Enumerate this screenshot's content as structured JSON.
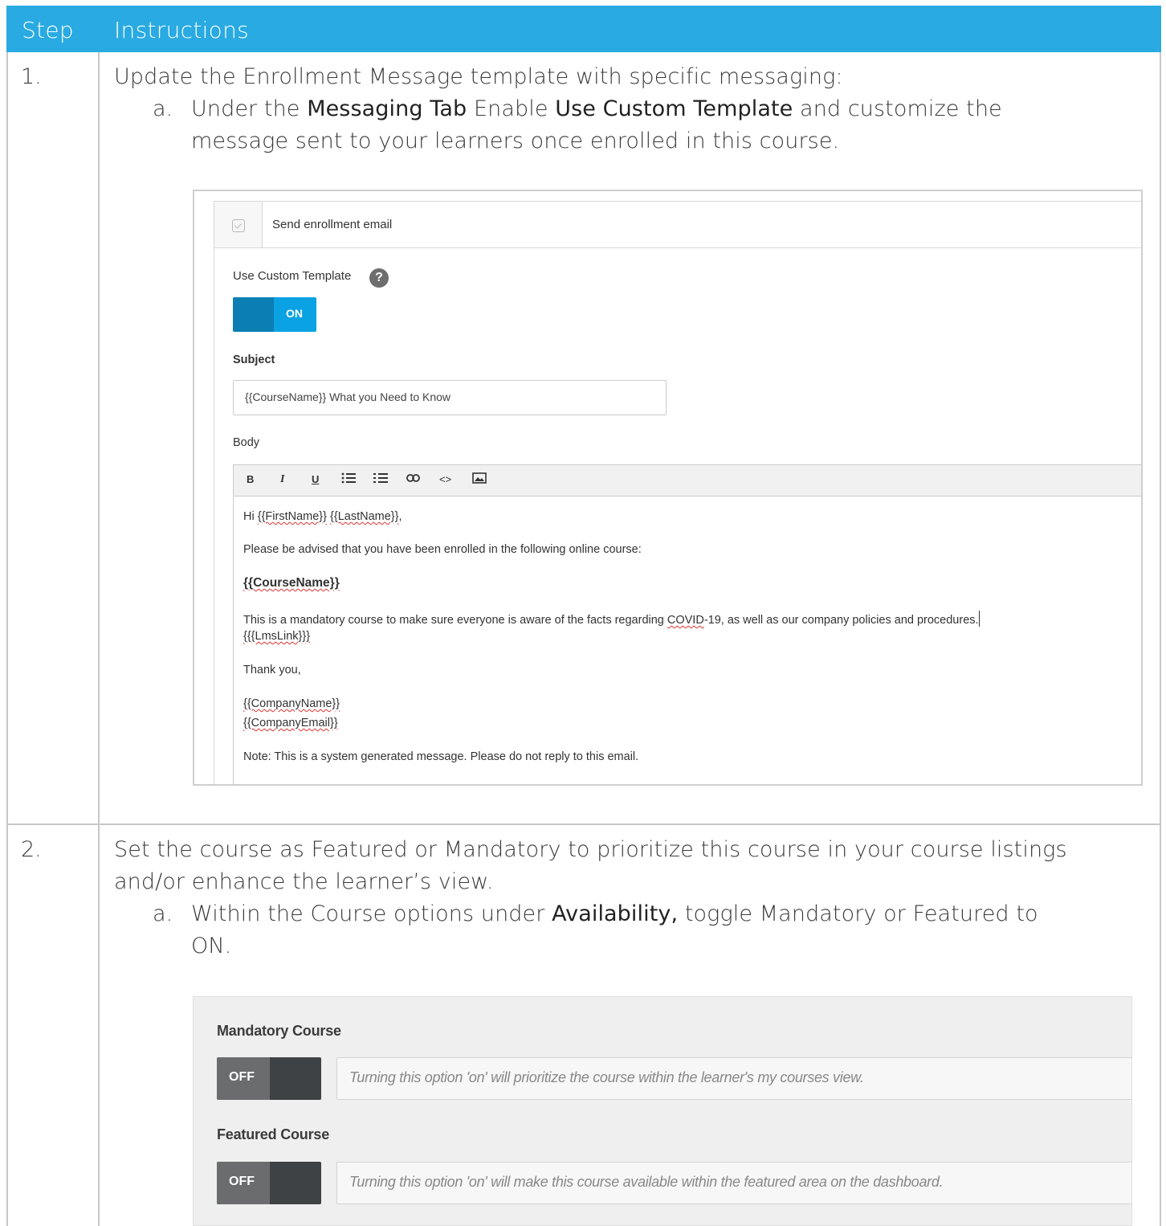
{
  "table": {
    "header": {
      "col1": "Step",
      "col2": "Instructions"
    },
    "row1": {
      "step": "1.",
      "intro": "Update the Enrollment Message template with specific messaging:",
      "sub_letter": "a.",
      "sub_pre": "Under the ",
      "sub_bold1": "Messaging Tab",
      "sub_mid": " Enable ",
      "sub_bold2": "Use Custom Template",
      "sub_post": " and customize the",
      "sub_line2": "message sent to your learners once enrolled in this course."
    },
    "row2": {
      "step": "2.",
      "intro_line1": "Set the course as Featured or Mandatory to prioritize this course in your course listings",
      "intro_line2": "and/or enhance the learner’s view.",
      "sub_letter": "a.",
      "sub_pre": "Within the Course options under ",
      "sub_bold": "Availability,",
      "sub_post": " toggle Mandatory or Featured to",
      "sub_line2": "ON."
    }
  },
  "screenshot1": {
    "send_email_label": "Send enrollment email",
    "custom_template_label": "Use Custom Template",
    "help_glyph": "?",
    "toggle_state": "ON",
    "subject_label": "Subject",
    "subject_value": "{{CourseName}} What you Need to Know",
    "body_label": "Body",
    "toolbar": {
      "bold": "B",
      "italic": "I",
      "underline": "U",
      "link": "ↂ",
      "code": "<>"
    },
    "body": {
      "greet_pre": "Hi ",
      "greet_first": "{{FirstName}}",
      "greet_space": " ",
      "greet_last": "{{LastName}}",
      "greet_post": ",",
      "advised": "Please be advised that you have been enrolled in the following online course:",
      "course_name": "{{CourseName}}",
      "mandatory_pre": "This is a mandatory course to make sure everyone is aware of the facts regarding ",
      "covid": "COVID",
      "mandatory_post": "-19, as well as our company policies and procedures.",
      "lms_link": "{{{LmsLink}}}",
      "thanks": "Thank you,",
      "company_name": "{{CompanyName}}",
      "company_email": "{{CompanyEmail}}",
      "note": "Note: This is a system generated message. Please do not reply to this email."
    }
  },
  "screenshot2": {
    "mandatory_label": "Mandatory Course",
    "mandatory_state": "OFF",
    "mandatory_hint": "Turning this option 'on' will prioritize the course within the learner's my courses view.",
    "featured_label": "Featured Course",
    "featured_state": "OFF",
    "featured_hint": "Turning this option 'on' will make this course available within the featured area on the dashboard."
  },
  "colors": {
    "header_bg": "#29aae2",
    "toggle_on": "#0aa2e3",
    "toggle_off": "#3f4245"
  }
}
